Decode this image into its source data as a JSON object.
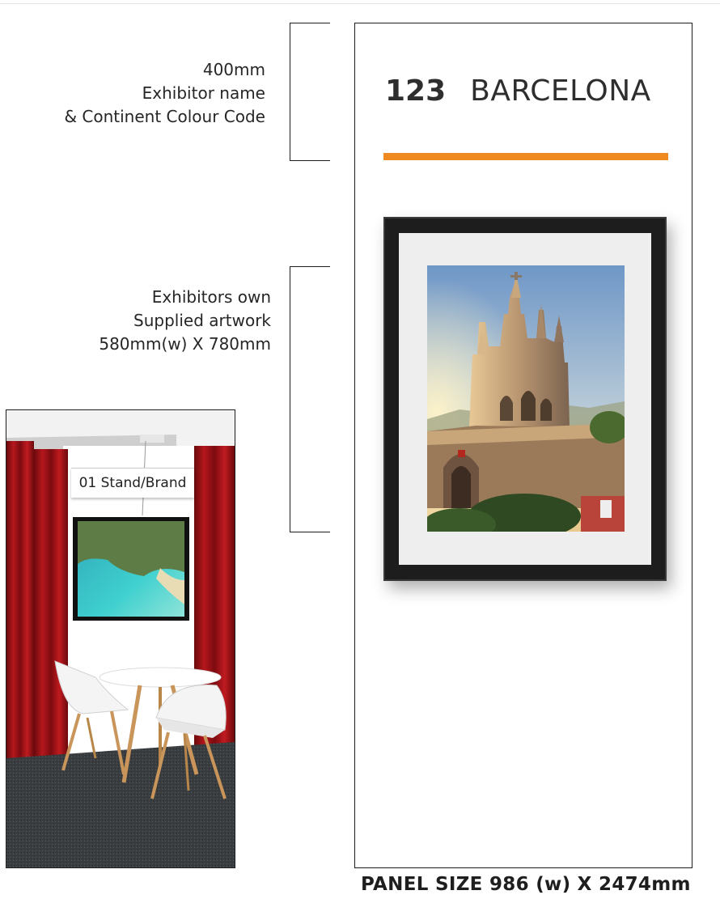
{
  "annotations": {
    "header_label": [
      "400mm",
      "Exhibitor name",
      "& Continent Colour Code"
    ],
    "artwork_label": [
      "Exhibitors own",
      "Supplied artwork",
      "580mm(w) X 780mm"
    ]
  },
  "panel": {
    "stand_number": "123",
    "exhibitor_name": "BARCELONA",
    "continent_colour": "#ef8a23",
    "size_caption": "PANEL SIZE 986 (w) X 2474mm"
  },
  "render": {
    "sign_text": "01 Stand/Brand"
  },
  "colors": {
    "frame": "#1d1d1d",
    "mat": "#eeeeee",
    "curtain": "#9e0f14",
    "carpet": "#3a3d40"
  }
}
